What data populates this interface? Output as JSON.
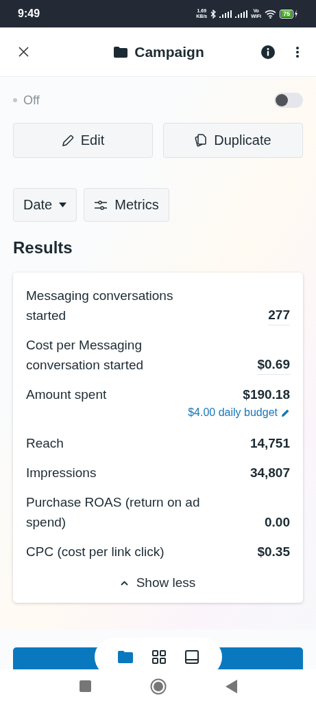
{
  "status_bar": {
    "time": "9:49",
    "speed": "1.69",
    "speed_unit": "KB/s",
    "vowifi": "Vo",
    "vowifi_sub": "WiFi",
    "battery": "75"
  },
  "header": {
    "title": "Campaign"
  },
  "campaign": {
    "status": "Off",
    "on": false
  },
  "actions": [
    {
      "label": "Edit",
      "kind": "edit"
    },
    {
      "label": "Duplicate",
      "kind": "duplicate"
    }
  ],
  "filters": [
    {
      "label": "Date",
      "kind": "dropdown"
    },
    {
      "label": "Metrics",
      "kind": "metrics"
    }
  ],
  "results": {
    "title": "Results",
    "metrics": [
      {
        "label": "Messaging conversations started",
        "value": "277",
        "divider": true
      },
      {
        "label": "Cost per Messaging conversation started",
        "value": "$0.69",
        "divider": true
      },
      {
        "label": "Amount spent",
        "value": "$190.18",
        "budget": "$4.00 daily budget"
      },
      {
        "label": "Reach",
        "value": "14,751"
      },
      {
        "label": "Impressions",
        "value": "34,807"
      },
      {
        "label": "Purchase ROAS (return on ad spend)",
        "value": "0.00"
      },
      {
        "label": "CPC (cost per link click)",
        "value": "$0.35"
      }
    ],
    "toggle_label": "Show less"
  },
  "bottom_tabs": [
    {
      "kind": "folder",
      "selected": true
    },
    {
      "kind": "grid",
      "selected": false
    },
    {
      "kind": "tablet",
      "selected": false
    }
  ]
}
